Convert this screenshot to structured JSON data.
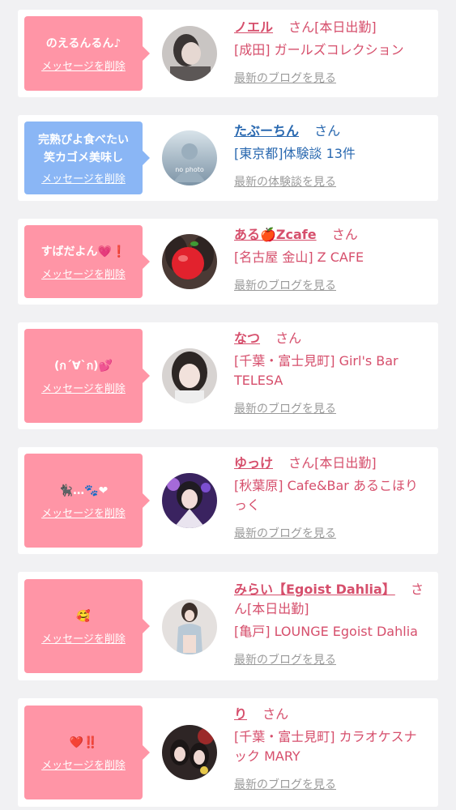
{
  "delete_label": "メッセージを削除",
  "san": "さん",
  "entries": [
    {
      "message": "のえるんるん♪",
      "name": "ノエル",
      "status": "[本日出勤]",
      "shop": "[成田] ガールズコレクション",
      "link": "最新のブログを見る"
    },
    {
      "message_line1": "完熟ぴよ食べたい",
      "message_line2": "笑カゴメ美味し",
      "name": "たぶーちん",
      "shop": "[東京都]体験談 13件",
      "link": "最新の体験談を見る",
      "avatar_text": "no photo"
    },
    {
      "message": "すばだよん💗❗",
      "name": "ある🍎Zcafe",
      "shop": "[名古屋 金山] Z CAFE",
      "link": "最新のブログを見る"
    },
    {
      "message": "(ก´∀`ก)💕",
      "name": "なつ",
      "shop_line1": "[千葉・富士見町] Girl's Bar",
      "shop_line2": "TELESA",
      "link": "最新のブログを見る"
    },
    {
      "message": "🐈‍⬛…🐾❤",
      "name": "ゆっけ",
      "status": "[本日出勤]",
      "shop_line1": "[秋葉原] Cafe&Bar あるこほり",
      "shop_line2": "っく",
      "link": "最新のブログを見る"
    },
    {
      "message": "🥰",
      "name": "みらい【Egoist Dahlia】",
      "san_wrap1": "さ",
      "san_wrap2": "ん",
      "status": "[本日出勤]",
      "shop": "[亀戸] LOUNGE Egoist Dahlia",
      "link": "最新のブログを見る"
    },
    {
      "message": "❤️‼️",
      "name": "り",
      "shop_line1": "[千葉・富士見町] カラオケスナ",
      "shop_line2": "ック MARY",
      "link": "最新のブログを見る"
    }
  ]
}
